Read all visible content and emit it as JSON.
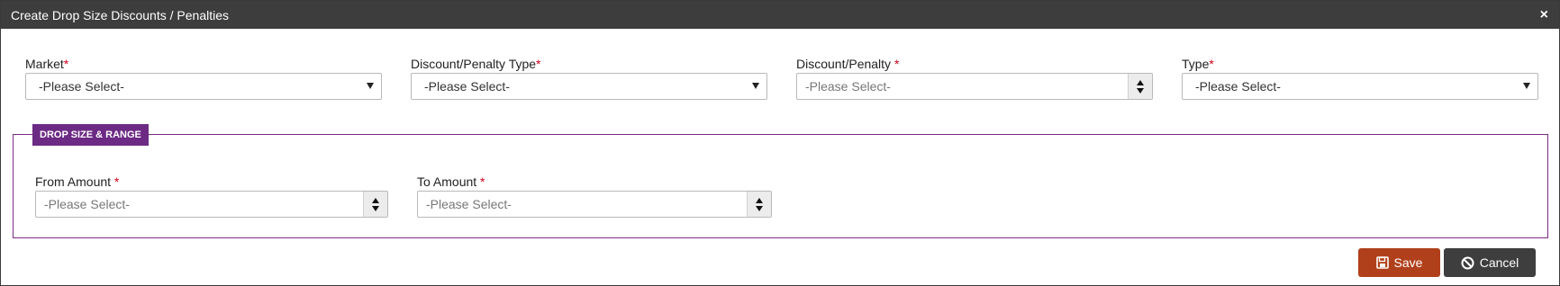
{
  "dialog": {
    "title": "Create Drop Size Discounts / Penalties",
    "close_label": "×"
  },
  "fields": {
    "market": {
      "label": "Market",
      "required": "*",
      "value": "-Please Select-"
    },
    "discount_type": {
      "label": "Discount/Penalty Type",
      "required": "*",
      "value": "-Please Select-"
    },
    "discount_penalty": {
      "label": "Discount/Penalty ",
      "required": "*",
      "placeholder": "-Please Select-"
    },
    "type": {
      "label": "Type",
      "required": "*",
      "value": "-Please Select-"
    }
  },
  "section": {
    "title": "DROP SIZE & RANGE",
    "from_amount": {
      "label": "From Amount ",
      "required": "*",
      "placeholder": "-Please Select-"
    },
    "to_amount": {
      "label": "To Amount ",
      "required": "*",
      "placeholder": "-Please Select-"
    }
  },
  "buttons": {
    "save_label": "Save",
    "cancel_label": "Cancel"
  },
  "colors": {
    "titlebar": "#3d3d3d",
    "section_accent": "#6c2a84",
    "save": "#b0401b",
    "cancel": "#3e3e3e"
  },
  "icons": [
    "close-icon",
    "caret-down-icon",
    "spinner-icon",
    "floppy-disk-icon",
    "ban-icon"
  ]
}
